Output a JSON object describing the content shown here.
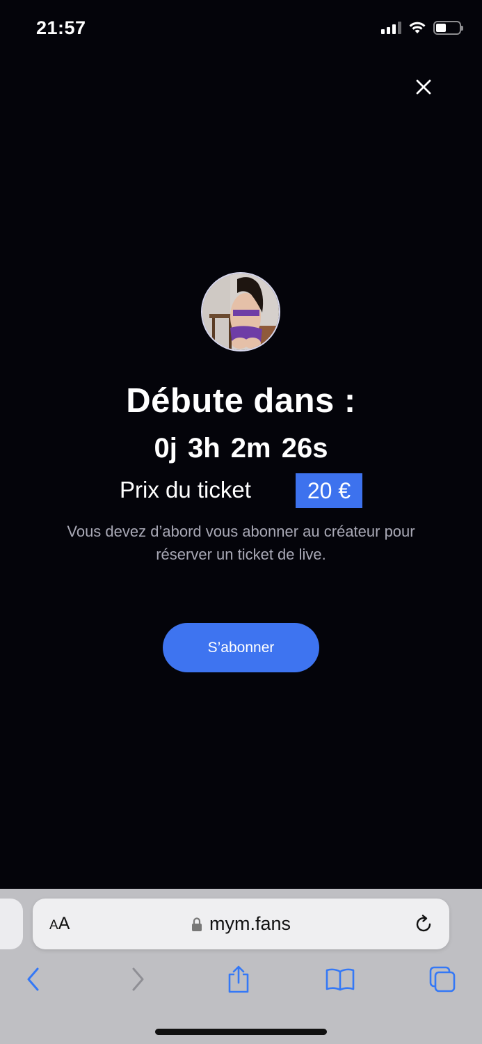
{
  "status_bar": {
    "time": "21:57",
    "signal_icon": "cellular-signal-icon",
    "wifi_icon": "wifi-icon",
    "battery_icon": "battery-icon",
    "battery_level": 0.45
  },
  "modal": {
    "close_icon": "close-icon",
    "avatar": "creator-avatar",
    "title": "Débute dans :",
    "countdown": "0j 3h 2m 26s",
    "price_label": "Prix du ticket",
    "price_value": "20 €",
    "info_line1": "Vous devez d’abord vous abonner au créateur pour",
    "info_line2": "réserver un ticket de live.",
    "subscribe_label": "S’abonner",
    "accent_color": "#3e74f0"
  },
  "browser": {
    "aa_label_small": "A",
    "aa_label_large": "A",
    "url": "mym.fans",
    "lock_icon": "lock-icon",
    "reload_icon": "reload-icon",
    "toolbar": [
      "back-icon",
      "forward-icon",
      "share-icon",
      "bookmarks-icon",
      "tabs-icon"
    ]
  }
}
